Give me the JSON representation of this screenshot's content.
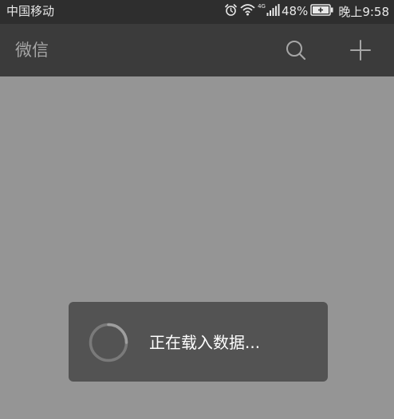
{
  "status_bar": {
    "carrier": "中国移动",
    "network_type": "4G",
    "battery_percent": "48%",
    "time": "晚上9:58",
    "icons": [
      "alarm-icon",
      "wifi-icon",
      "signal-icon",
      "battery-charging-icon"
    ]
  },
  "app_bar": {
    "title": "微信",
    "icons": [
      "search-icon",
      "add-icon"
    ]
  },
  "loading": {
    "text": "正在载入数据..."
  },
  "colors": {
    "status_bar_bg": "#2e2e2e",
    "app_bar_bg": "#3b3b3b",
    "overlay_bg": "#959595",
    "toast_bg": "#535353"
  }
}
